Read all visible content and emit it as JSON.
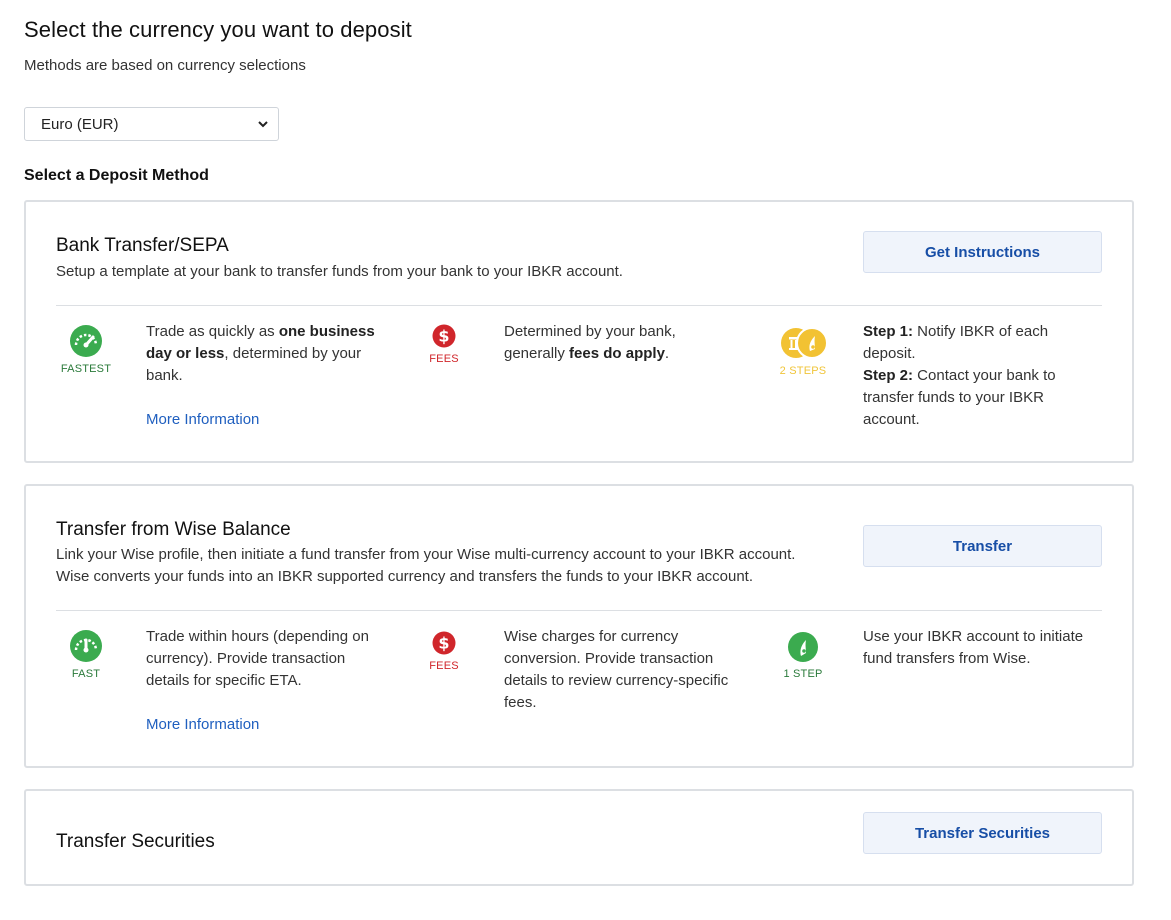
{
  "header": {
    "title": "Select the currency you want to deposit",
    "subtitle": "Methods are based on currency selections"
  },
  "currency_select": {
    "value": "Euro (EUR)"
  },
  "section_label": "Select a Deposit Method",
  "cards": [
    {
      "title": "Bank Transfer/SEPA",
      "desc_line1": "Setup a template at your bank to transfer funds from your bank to your IBKR account.",
      "button": "Get Instructions",
      "speed": {
        "caption": "FASTEST",
        "text_pre": "Trade as quickly as ",
        "text_bold1": "one business",
        "text_bold2": "day or less",
        "text_post": ", determined by your",
        "text_line3": "bank.",
        "link": "More Information"
      },
      "fees": {
        "caption": "FEES",
        "line1": "Determined by your bank,",
        "line2_pre": "generally ",
        "line2_bold": "fees do apply",
        "line2_post": "."
      },
      "steps": {
        "caption": "2 STEPS",
        "s1_label": "Step 1:",
        "s1_text1": " Notify IBKR of each",
        "s1_text2": "deposit.",
        "s2_label": "Step 2:",
        "s2_text1": " Contact your bank to",
        "s2_text2": "transfer funds to your IBKR",
        "s2_text3": "account."
      }
    },
    {
      "title": "Transfer from Wise Balance",
      "desc_line1": "Link your Wise profile, then initiate a fund transfer from your Wise multi-currency account to your IBKR account.",
      "desc_line2": "Wise converts your funds into an IBKR supported currency and transfers the funds to your IBKR account.",
      "button": "Transfer",
      "speed": {
        "caption": "FAST",
        "line1": "Trade within hours (depending on",
        "line2": "currency). Provide transaction",
        "line3": "details for specific ETA.",
        "link": "More Information"
      },
      "fees": {
        "caption": "FEES",
        "line1": "Wise charges for currency",
        "line2": "conversion. Provide transaction",
        "line3": "details to review currency-specific",
        "line4": "fees."
      },
      "steps": {
        "caption": "1 STEP",
        "line1": "Use your IBKR account to initiate",
        "line2": "fund transfers from Wise."
      }
    },
    {
      "title": "Transfer Securities",
      "button": "Transfer Securities"
    }
  ],
  "colors": {
    "green": "#3bab4f",
    "red": "#d0262b",
    "gold": "#f2c233",
    "link": "#1f5fbf",
    "button_text": "#174ea6"
  },
  "icons": [
    "chevron-down-icon",
    "speedometer-icon",
    "dollar-fee-icon",
    "steps-icon"
  ]
}
